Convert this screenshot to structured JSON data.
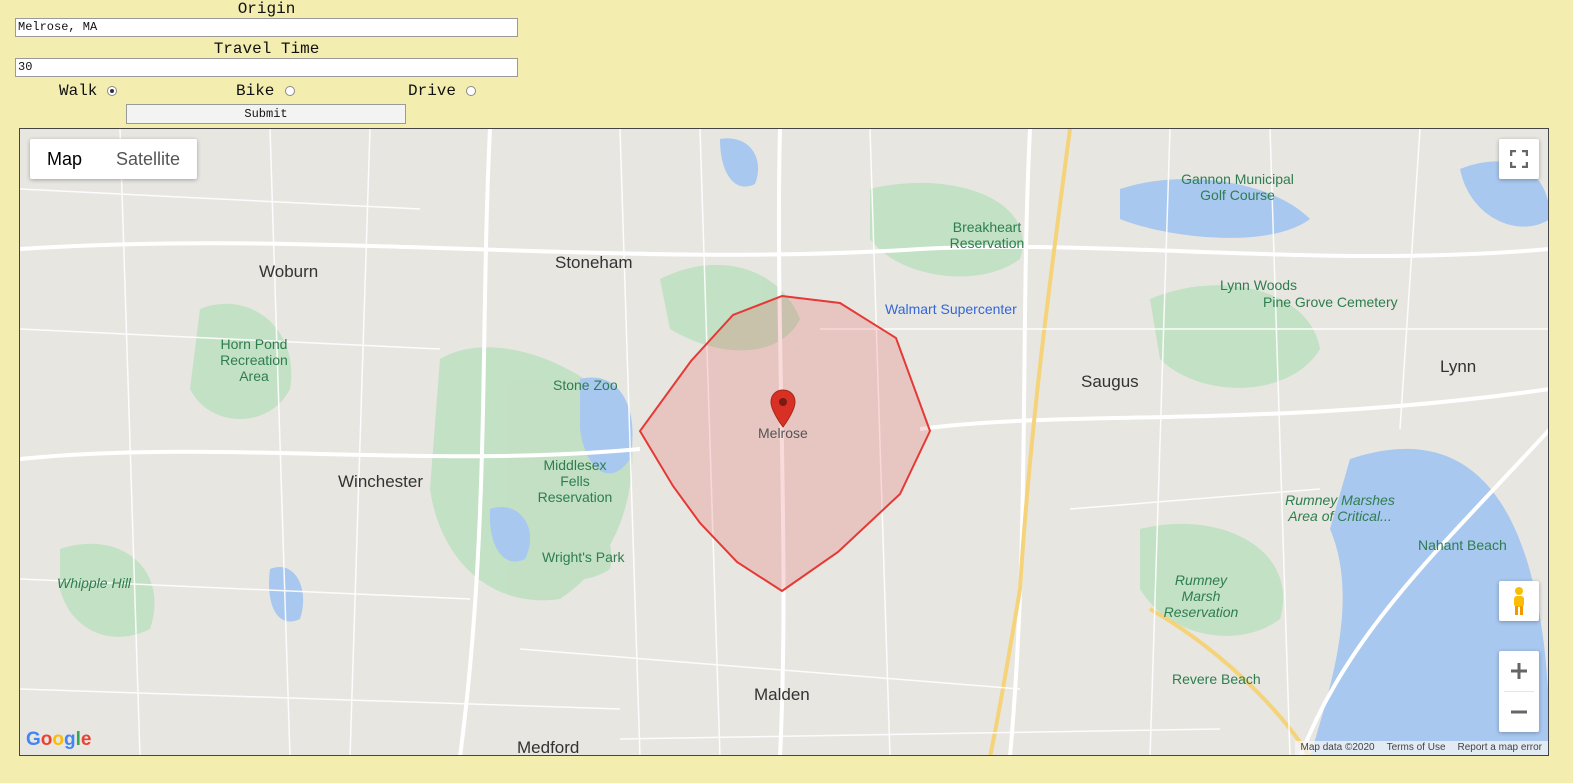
{
  "form": {
    "origin_label": "Origin",
    "origin_value": "Melrose, MA",
    "travel_time_label": "Travel Time",
    "travel_time_value": "30",
    "modes": [
      {
        "label": "Walk",
        "checked": true
      },
      {
        "label": "Bike",
        "checked": false
      },
      {
        "label": "Drive",
        "checked": false
      }
    ],
    "submit_label": "Submit"
  },
  "map": {
    "map_type_options": [
      "Map",
      "Satellite"
    ],
    "active_map_type": "Map",
    "marker_label": "Melrose",
    "places": {
      "stoneham": "Stoneham",
      "woburn": "Woburn",
      "winchester": "Winchester",
      "malden": "Malden",
      "medford": "Medford",
      "saugus": "Saugus",
      "lynn": "Lynn",
      "stone_zoo": "Stone Zoo",
      "middlesex": "Middlesex Fells Reservation",
      "wrights_park": "Wright's Park",
      "horn_pond": "Horn Pond Recreation Area",
      "whipple_hill": "Whipple Hill",
      "breakheart": "Breakheart Reservation",
      "walmart": "Walmart Supercenter",
      "lynn_woods": "Lynn Woods",
      "pine_grove": "Pine Grove Cemetery",
      "gannon": "Gannon Municipal Golf Course",
      "rumney_area": "Rumney Marshes Area of Critical...",
      "rumney_marsh": "Rumney Marsh Reservation",
      "nahant_beach": "Nahant Beach",
      "revere_beach": "Revere Beach"
    },
    "footer": {
      "map_data": "Map data ©2020",
      "terms": "Terms of Use",
      "report": "Report a map error"
    },
    "logo": "Google",
    "colors": {
      "isochrone_stroke": "#e53935",
      "marker": "#d93025"
    }
  }
}
